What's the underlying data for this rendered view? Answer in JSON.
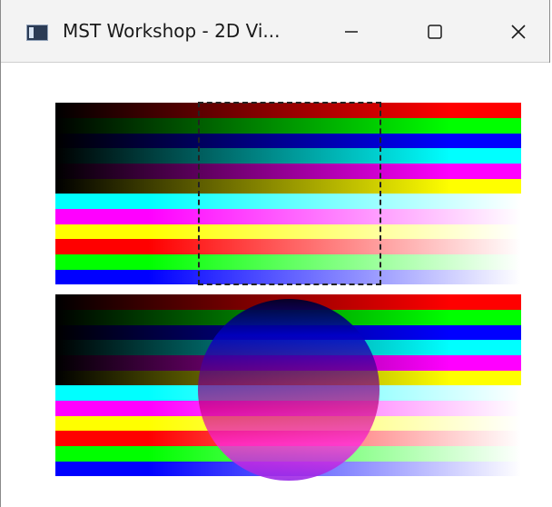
{
  "window": {
    "title": "MST Workshop - 2D Vi...",
    "icon": "app-window-icon",
    "controls": {
      "minimize_icon": "minimize-icon",
      "maximize_icon": "maximize-icon",
      "close_icon": "close-icon"
    }
  },
  "viewport": {
    "background": "#ffffff",
    "panels": [
      {
        "id": "top",
        "strip_colors": [
          "#ff0000",
          "#00ff00",
          "#0000ff",
          "#00ffff",
          "#ff00ff",
          "#ffff00",
          "#00ffff",
          "#ff00ff",
          "#ffff00",
          "#ff0000",
          "#00ff00",
          "#0000ff"
        ],
        "has_selection": true
      },
      {
        "id": "bottom",
        "strip_colors": [
          "#ff0000",
          "#00ff00",
          "#0000ff",
          "#00ffff",
          "#ff00ff",
          "#ffff00",
          "#00ffff",
          "#ff00ff",
          "#ffff00",
          "#ff0000",
          "#00ff00",
          "#0000ff"
        ],
        "has_circle": true
      }
    ]
  }
}
